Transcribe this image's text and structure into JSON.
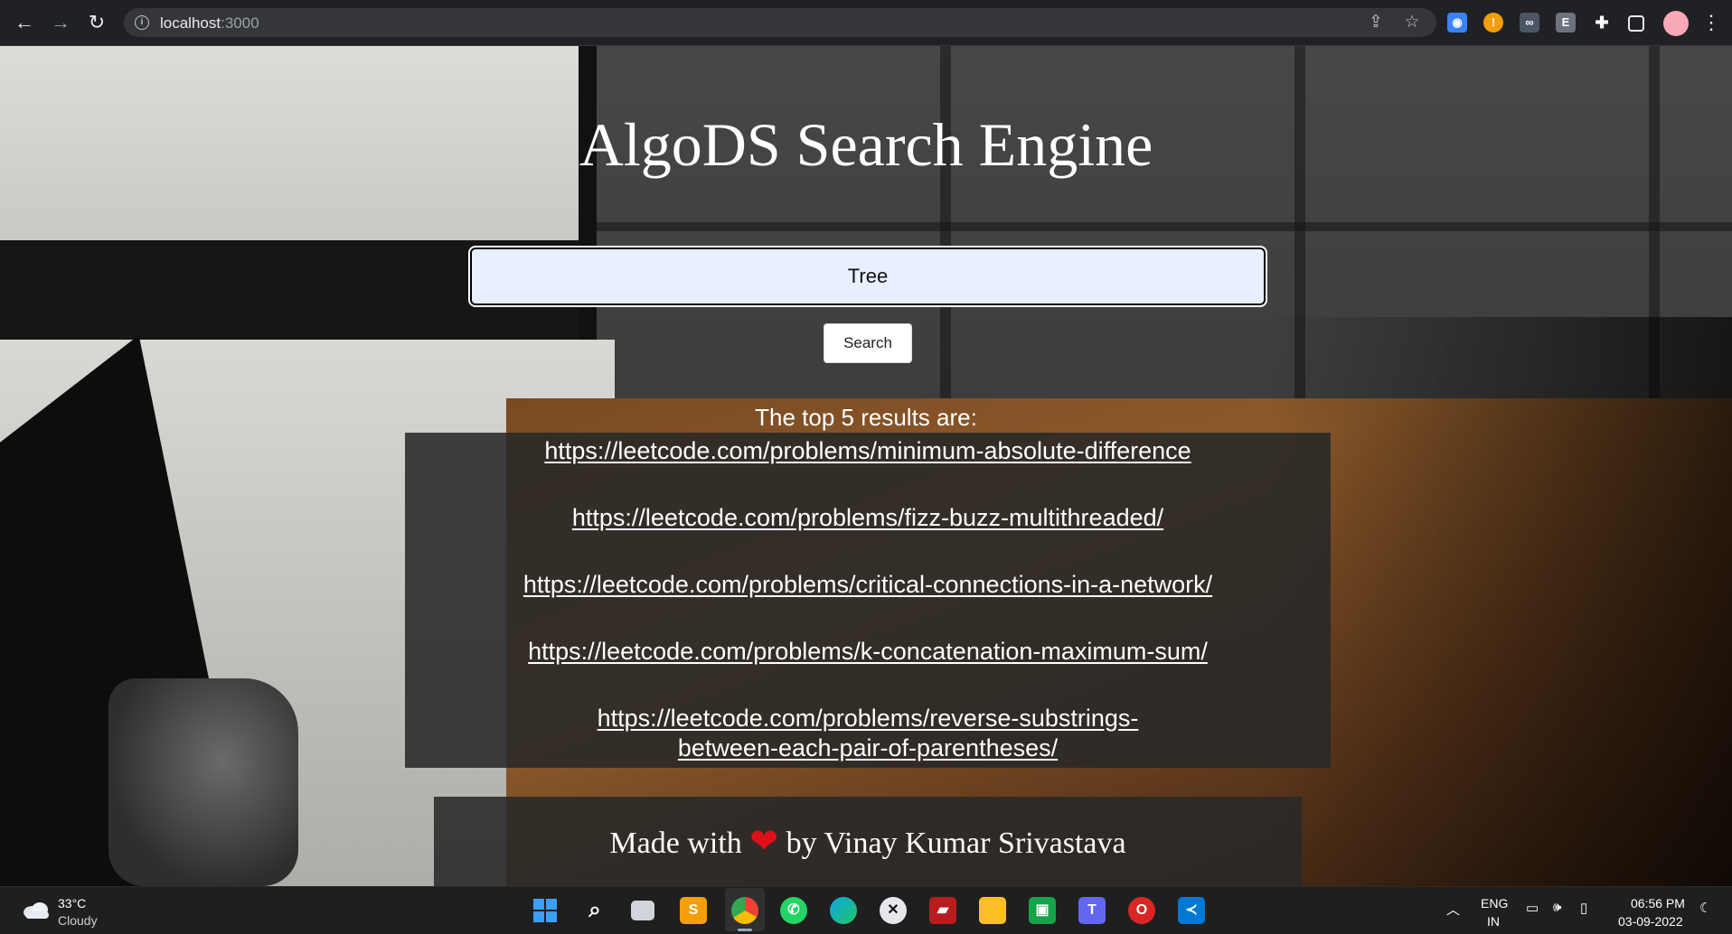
{
  "browser": {
    "url_host": "localhost",
    "url_port": ":3000"
  },
  "page": {
    "title": "AlgoDS Search Engine",
    "search": {
      "value": "Tree"
    },
    "search_button": "Search",
    "results_heading": "The top 5 results are:",
    "results": [
      "https://leetcode.com/problems/minimum-absolute-difference",
      "https://leetcode.com/problems/fizz-buzz-multithreaded/",
      "https://leetcode.com/problems/critical-connections-in-a-network/",
      "https://leetcode.com/problems/k-concatenation-maximum-sum/",
      "https://leetcode.com/problems/reverse-substrings-between-each-pair-of-parentheses/"
    ],
    "footer": {
      "before": "Made with",
      "heart": "❤",
      "after": "by Vinay Kumar Srivastava"
    }
  },
  "taskbar": {
    "weather_temp": "33°C",
    "weather_desc": "Cloudy",
    "lang": "ENG",
    "region": "IN",
    "time": "06:56 PM",
    "date": "03-09-2022"
  },
  "colors": {
    "accent_heart": "#e0101a",
    "input_bg": "#e8f0fe",
    "panel_bg": "#282828"
  }
}
